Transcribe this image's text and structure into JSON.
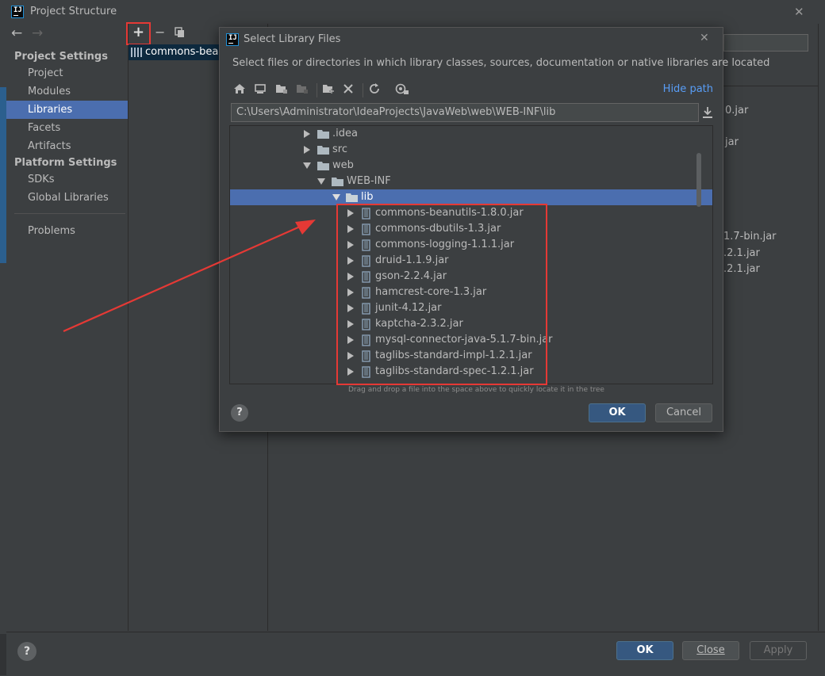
{
  "window": {
    "title": "Project Structure",
    "close_glyph": "✕"
  },
  "nav": {
    "back_glyph": "←",
    "forward_glyph": "→"
  },
  "sidebar": {
    "project_settings_header": "Project Settings",
    "project": "Project",
    "modules": "Modules",
    "libraries": "Libraries",
    "facets": "Facets",
    "artifacts": "Artifacts",
    "platform_settings_header": "Platform Settings",
    "sdks": "SDKs",
    "global_libraries": "Global Libraries",
    "problems": "Problems"
  },
  "middle_toolbar": {
    "add_glyph": "+",
    "remove_glyph": "−"
  },
  "library_list": {
    "selected_item": "commons-bean"
  },
  "background_fragments": {
    "frag1": "0.jar",
    "frag2": "jar",
    "frag3": "1.7-bin.jar",
    "frag4": ".2.1.jar",
    "frag5": ".2.1.jar"
  },
  "dialog": {
    "title": "Select Library Files",
    "close_glyph": "✕",
    "description": "Select files or directories in which library classes, sources, documentation or native libraries are located",
    "hide_path": "Hide path",
    "path_value": "C:\\Users\\Administrator\\IdeaProjects\\JavaWeb\\web\\WEB-INF\\lib",
    "tree": {
      "idea": ".idea",
      "src": "src",
      "web": "web",
      "web_inf": "WEB-INF",
      "lib": "lib",
      "jars": [
        "commons-beanutils-1.8.0.jar",
        "commons-dbutils-1.3.jar",
        "commons-logging-1.1.1.jar",
        "druid-1.1.9.jar",
        "gson-2.2.4.jar",
        "hamcrest-core-1.3.jar",
        "junit-4.12.jar",
        "kaptcha-2.3.2.jar",
        "mysql-connector-java-5.1.7-bin.jar",
        "taglibs-standard-impl-1.2.1.jar",
        "taglibs-standard-spec-1.2.1.jar"
      ]
    },
    "hint": "Drag and drop a file into the space above to quickly locate it in the tree",
    "help_glyph": "?",
    "ok": "OK",
    "cancel": "Cancel"
  },
  "footer": {
    "help_glyph": "?",
    "ok": "OK",
    "close": "Close",
    "apply": "Apply"
  },
  "annotation_color": "#e53935",
  "accent_selection": "#4b6eaf",
  "icons": [
    "intellij-logo-icon",
    "back-arrow-icon",
    "forward-arrow-icon",
    "add-icon",
    "remove-icon",
    "copy-icon",
    "library-icon",
    "home-icon",
    "desktop-icon",
    "project-folder-icon",
    "module-folder-icon",
    "new-folder-icon",
    "delete-icon",
    "refresh-icon",
    "show-hidden-icon",
    "download-icon",
    "folder-icon",
    "jar-icon",
    "expand-arrow-icon",
    "collapse-arrow-icon",
    "help-icon",
    "close-icon"
  ]
}
